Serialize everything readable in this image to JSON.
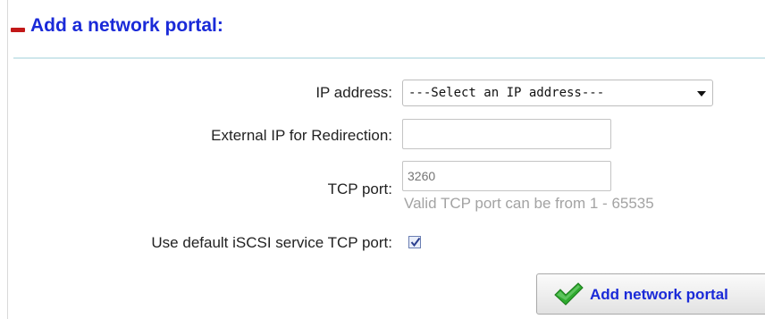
{
  "section": {
    "title": "Add a network portal",
    "collapse_icon": "collapse-minus-icon",
    "title_color": "#1a2ad8",
    "icon_color": "#c21818"
  },
  "form": {
    "ip_address": {
      "label": "IP address:",
      "selected": "---Select an IP address---"
    },
    "external_ip": {
      "label": "External IP for Redirection:",
      "value": ""
    },
    "tcp_port": {
      "label": "TCP port:",
      "placeholder": "3260",
      "hint": "Valid TCP port can be from 1 - 65535"
    },
    "use_default_port": {
      "label": "Use default iSCSI service TCP port:",
      "checked": true
    }
  },
  "actions": {
    "add_label": "Add network portal",
    "add_icon": "checkmark-icon",
    "accent_color": "#2eaa2e"
  }
}
